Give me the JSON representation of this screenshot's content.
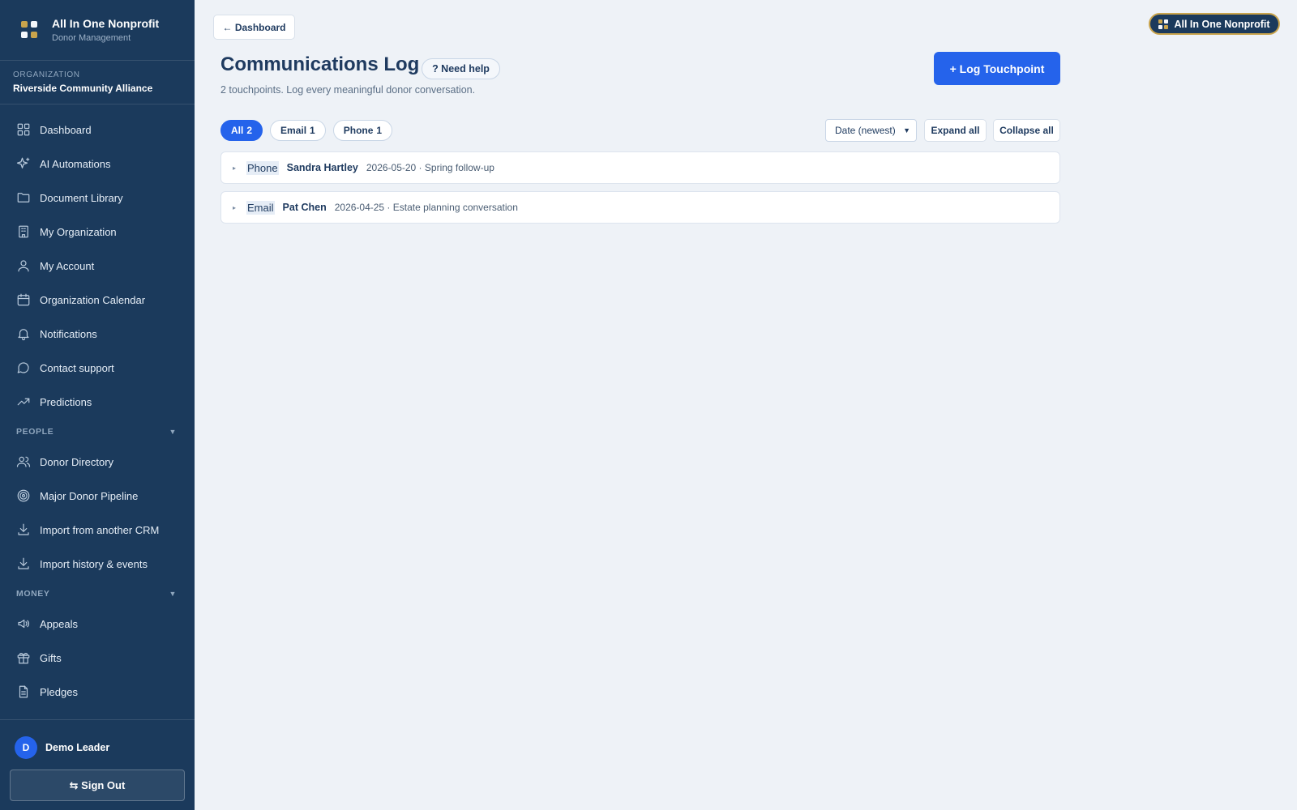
{
  "brand": {
    "name": "All In One Nonprofit",
    "subtitle": "Donor Management",
    "logo_colors": [
      "#c9a44c",
      "#f4f7fb",
      "#f4f7fb",
      "#c9a44c"
    ]
  },
  "organization": {
    "label": "ORGANIZATION",
    "name": "Riverside Community Alliance"
  },
  "nav": {
    "items_top": [
      {
        "label": "Dashboard",
        "icon": "grid-icon"
      },
      {
        "label": "AI Automations",
        "icon": "sparkle-icon"
      },
      {
        "label": "Document Library",
        "icon": "folder-icon"
      },
      {
        "label": "My Organization",
        "icon": "building-icon"
      },
      {
        "label": "My Account",
        "icon": "user-icon"
      },
      {
        "label": "Organization Calendar",
        "icon": "calendar-icon"
      },
      {
        "label": "Notifications",
        "icon": "bell-icon"
      },
      {
        "label": "Contact support",
        "icon": "chat-icon"
      },
      {
        "label": "Predictions",
        "icon": "trend-icon"
      }
    ],
    "people": {
      "label": "PEOPLE",
      "items": [
        {
          "label": "Donor Directory",
          "icon": "users-icon"
        },
        {
          "label": "Major Donor Pipeline",
          "icon": "target-icon"
        },
        {
          "label": "Import from another CRM",
          "icon": "download-icon"
        },
        {
          "label": "Import history & events",
          "icon": "download-icon"
        }
      ]
    },
    "money": {
      "label": "MONEY",
      "items": [
        {
          "label": "Appeals",
          "icon": "megaphone-icon"
        },
        {
          "label": "Gifts",
          "icon": "gift-icon"
        },
        {
          "label": "Pledges",
          "icon": "document-icon"
        }
      ]
    }
  },
  "user": {
    "initial": "D",
    "name": "Demo Leader",
    "sign_out": "⇆ Sign Out"
  },
  "header": {
    "back_label": "← Dashboard",
    "app_pill": "All In One Nonprofit"
  },
  "page": {
    "title": "Communications Log",
    "help_label": "? Need help",
    "subtitle": "2 touchpoints. Log every meaningful donor conversation.",
    "log_button": "+ Log Touchpoint"
  },
  "filters": [
    {
      "label": "All",
      "count": "2",
      "active": true
    },
    {
      "label": "Email",
      "count": "1",
      "active": false
    },
    {
      "label": "Phone",
      "count": "1",
      "active": false
    }
  ],
  "controls": {
    "sort_value": "Date (newest)",
    "expand_all": "Expand all",
    "collapse_all": "Collapse all"
  },
  "entries": [
    {
      "type": "Phone",
      "donor": "Sandra Hartley",
      "meta": "2026-05-20 · Spring follow-up"
    },
    {
      "type": "Email",
      "donor": "Pat Chen",
      "meta": "2026-04-25 · Estate planning conversation"
    }
  ],
  "colors": {
    "sidebar_bg": "#1b3a5c",
    "accent": "#2563eb",
    "gold": "#c9a44c",
    "page_bg": "#eef2f7"
  }
}
